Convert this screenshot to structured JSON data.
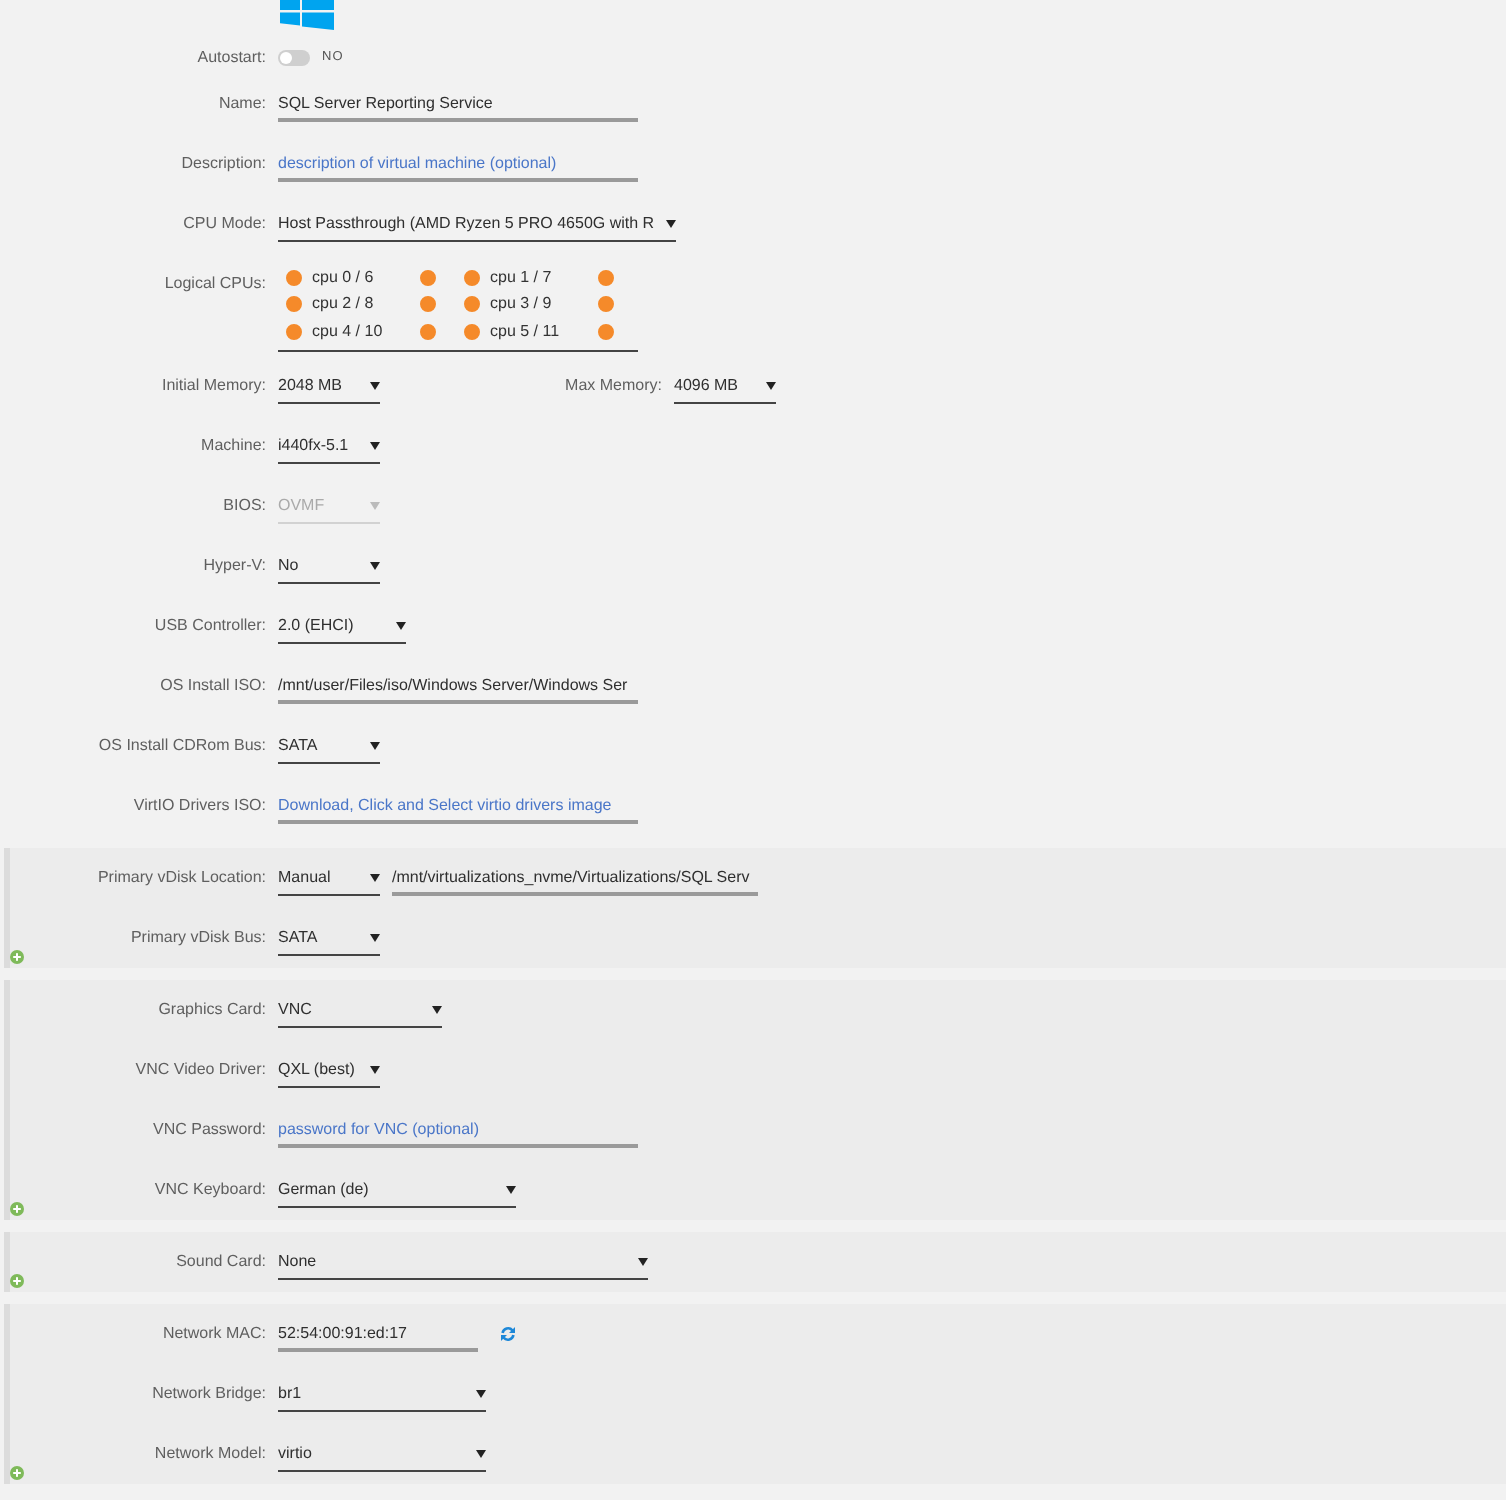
{
  "sections": [
    {
      "kind": "plain",
      "rows": [
        {
          "kind": "icon"
        },
        {
          "kind": "toggle",
          "label": "Autostart:",
          "on": false,
          "text": "NO"
        },
        {
          "kind": "input",
          "label": "Name:",
          "value": "SQL Server Reporting Service",
          "disabled": false
        },
        {
          "kind": "input",
          "label": "Description:",
          "placeholder": "description of virtual machine (optional)",
          "disabled": false
        },
        {
          "kind": "select",
          "label": "CPU Mode:",
          "value": "Host Passthrough (AMD Ryzen 5 PRO 4650G with R",
          "disabled": false
        },
        {
          "kind": "cpus",
          "label": "Logical CPUs:",
          "cpus": [
            {
              "label": "cpu 0 / 6",
              "threads": [
                {
                  "checked": true
                },
                {
                  "checked": true
                }
              ]
            },
            {
              "label": "cpu 1 / 7",
              "threads": [
                {
                  "checked": true
                },
                {
                  "checked": true
                }
              ]
            },
            {
              "label": "cpu 2 / 8",
              "threads": [
                {
                  "checked": true
                },
                {
                  "checked": true
                }
              ]
            },
            {
              "label": "cpu 3 / 9",
              "threads": [
                {
                  "checked": true
                },
                {
                  "checked": true
                }
              ]
            },
            {
              "label": "cpu 4 / 10",
              "threads": [
                {
                  "checked": true
                },
                {
                  "checked": true
                }
              ]
            },
            {
              "label": "cpu 5 / 11",
              "threads": [
                {
                  "checked": true
                },
                {
                  "checked": true
                }
              ]
            }
          ]
        },
        {
          "kind": "select",
          "label": "Initial Memory:",
          "value": "2048 MB",
          "disabled": false,
          "second": {
            "label": "Max Memory:",
            "value": "4096 MB",
            "disabled": false
          }
        },
        {
          "kind": "select",
          "label": "Machine:",
          "value": "i440fx-5.1",
          "disabled": false
        },
        {
          "kind": "select",
          "label": "BIOS:",
          "value": "OVMF",
          "disabled": true
        },
        {
          "kind": "select",
          "label": "Hyper-V:",
          "value": "No",
          "disabled": false
        },
        {
          "kind": "select",
          "label": "USB Controller:",
          "value": "2.0 (EHCI)",
          "disabled": false
        },
        {
          "kind": "input",
          "label": "OS Install ISO:",
          "value": "/mnt/user/Files/iso/Windows Server/Windows Ser",
          "disabled": false
        },
        {
          "kind": "select",
          "label": "OS Install CDRom Bus:",
          "value": "SATA",
          "disabled": false
        },
        {
          "kind": "input",
          "label": "VirtIO Drivers ISO:",
          "placeholder": "Download, Click and Select virtio drivers image",
          "disabled": false
        }
      ]
    },
    {
      "kind": "panel",
      "rows": [
        {
          "kind": "select",
          "label": "Primary vDisk Location:",
          "value": "Manual",
          "disabled": false,
          "path": {
            "value": "/mnt/virtualizations_nvme/Virtualizations/SQL Serv",
            "disabled": false
          }
        },
        {
          "kind": "select",
          "label": "Primary vDisk Bus:",
          "value": "SATA",
          "disabled": false
        }
      ]
    },
    {
      "kind": "panel",
      "rows": [
        {
          "kind": "select",
          "label": "Graphics Card:",
          "value": "VNC",
          "disabled": false
        },
        {
          "kind": "select",
          "label": "VNC Video Driver:",
          "value": "QXL (best)",
          "disabled": false
        },
        {
          "kind": "input",
          "label": "VNC Password:",
          "placeholder": "password for VNC (optional)",
          "disabled": false
        },
        {
          "kind": "select",
          "label": "VNC Keyboard:",
          "value": "German (de)",
          "disabled": false
        }
      ]
    },
    {
      "kind": "panel",
      "rows": [
        {
          "kind": "select",
          "label": "Sound Card:",
          "value": "None",
          "disabled": false
        }
      ]
    },
    {
      "kind": "panel",
      "rows": [
        {
          "kind": "mac",
          "label": "Network MAC:",
          "value": "52:54:00:91:ed:17",
          "disabled": false
        },
        {
          "kind": "select",
          "label": "Network Bridge:",
          "value": "br1",
          "disabled": false
        },
        {
          "kind": "select",
          "label": "Network Model:",
          "value": "virtio",
          "disabled": false
        }
      ]
    }
  ]
}
